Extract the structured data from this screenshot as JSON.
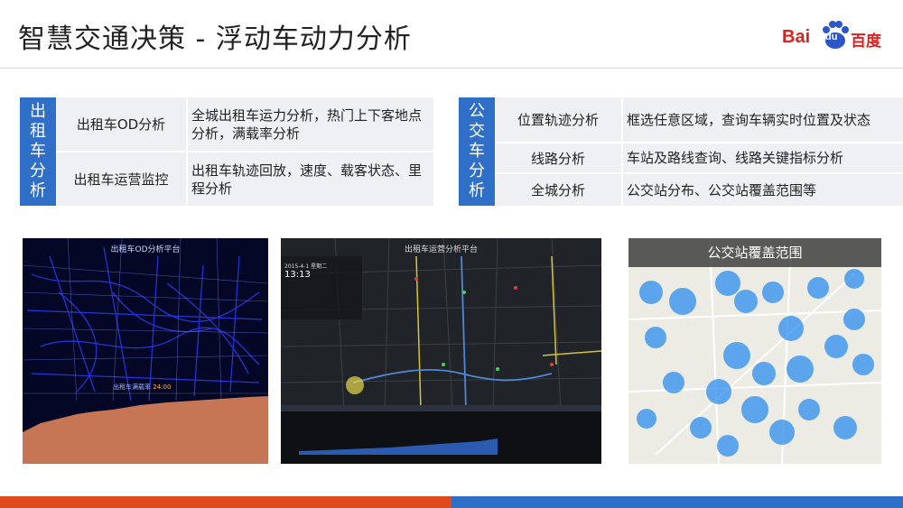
{
  "slide": {
    "title": "智慧交通决策 - 浮动车动力分析"
  },
  "logo": {
    "bai": "Bai",
    "du": "du",
    "cn": "百度"
  },
  "taxi": {
    "category": [
      "出",
      "租",
      "车",
      "分",
      "析"
    ],
    "rows": [
      {
        "name": "出租车OD分析",
        "desc": "全城出租车运力分析，热门上下客地点分析，满载率分析"
      },
      {
        "name": "出租车运营监控",
        "desc": "出租车轨迹回放，速度、载客状态、里程分析"
      }
    ]
  },
  "bus": {
    "category": [
      "公",
      "交",
      "车",
      "分",
      "析"
    ],
    "rows": [
      {
        "name": "位置轨迹分析",
        "desc": "框选任意区域，查询车辆实时位置及状态"
      },
      {
        "name": "线路分析",
        "desc": "车站及路线查询、线路关键指标分析"
      },
      {
        "name": "全城分析",
        "desc": "公交站分布、公交站覆盖范围等"
      }
    ]
  },
  "screens": {
    "od": {
      "title": "出租车OD分析平台",
      "load_label": "出租车满载率",
      "time": "24:00"
    },
    "ops": {
      "title": "出租车运营分析平台",
      "date": "2015-4-1 星期二",
      "clock": "13:13"
    },
    "coverage": {
      "title": "公交站覆盖范围"
    }
  },
  "colors": {
    "accent_blue": "#2f6fc8",
    "accent_red": "#e04a1a",
    "brand_red": "#e02020"
  }
}
